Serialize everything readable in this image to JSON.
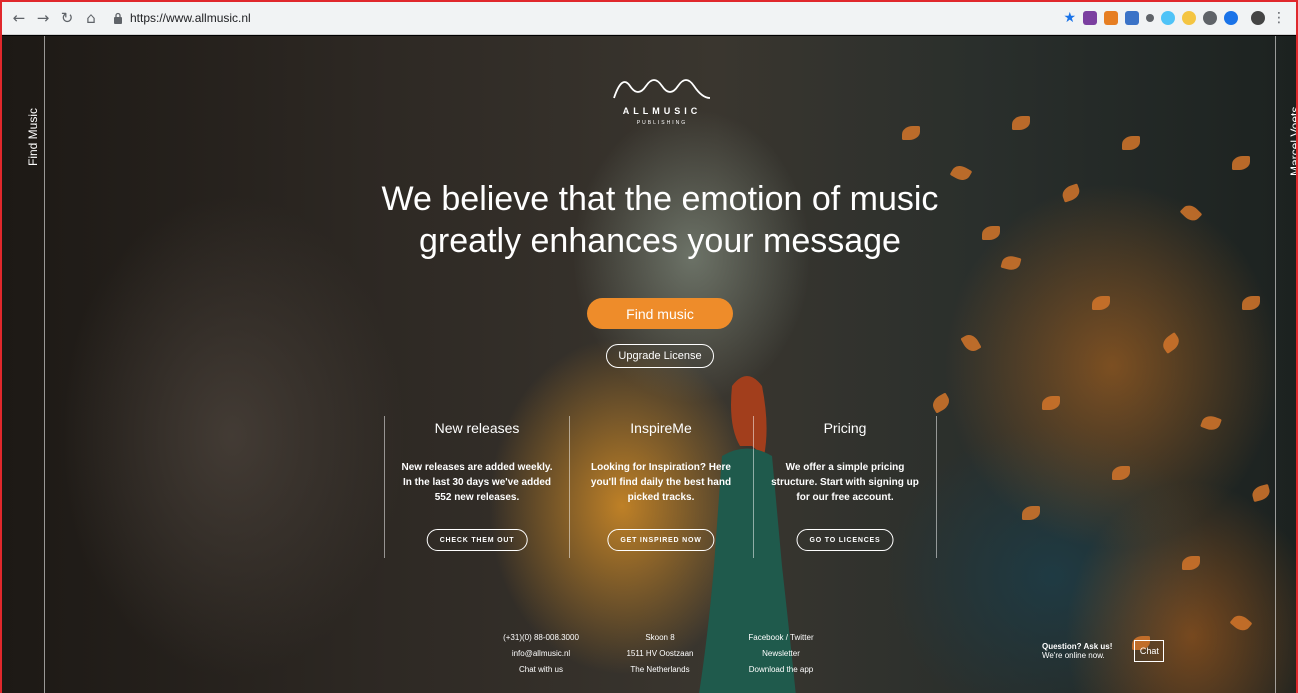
{
  "browser": {
    "url": "https://www.allmusic.nl"
  },
  "site": {
    "logo_name": "ALLMUSIC",
    "logo_sub": "PUBLISHING",
    "side_left": "Find Music",
    "side_right": "Marcel Voets",
    "headline_line1": "We believe that the emotion of music",
    "headline_line2": "greatly enhances your message",
    "find_button": "Find music",
    "upgrade_button": "Upgrade License",
    "accent_color": "#ee8c2a"
  },
  "features": [
    {
      "title": "New releases",
      "text": [
        "New releases are added weekly.",
        "In the last 30 days we've added",
        "552 new releases."
      ],
      "button": "CHECK THEM OUT"
    },
    {
      "title": "InspireMe",
      "text": [
        "Looking for Inspiration? Here",
        "you'll find daily the best hand",
        "picked tracks."
      ],
      "button": "GET INSPIRED NOW"
    },
    {
      "title": "Pricing",
      "text": [
        "We offer a simple pricing",
        "structure. Start with signing up",
        "for our free account."
      ],
      "button": "GO TO LICENCES"
    }
  ],
  "footer": {
    "contact": [
      "(+31)(0) 88-008.3000",
      "info@allmusic.nl",
      "Chat with us"
    ],
    "address": [
      "Skoon 8",
      "1511 HV Oostzaan",
      "The Netherlands"
    ],
    "links": [
      "Facebook / Twitter",
      "Newsletter",
      "Download the app"
    ]
  },
  "chat": {
    "question": "Question? Ask us!",
    "status": "We're online now.",
    "label": "Chat"
  }
}
